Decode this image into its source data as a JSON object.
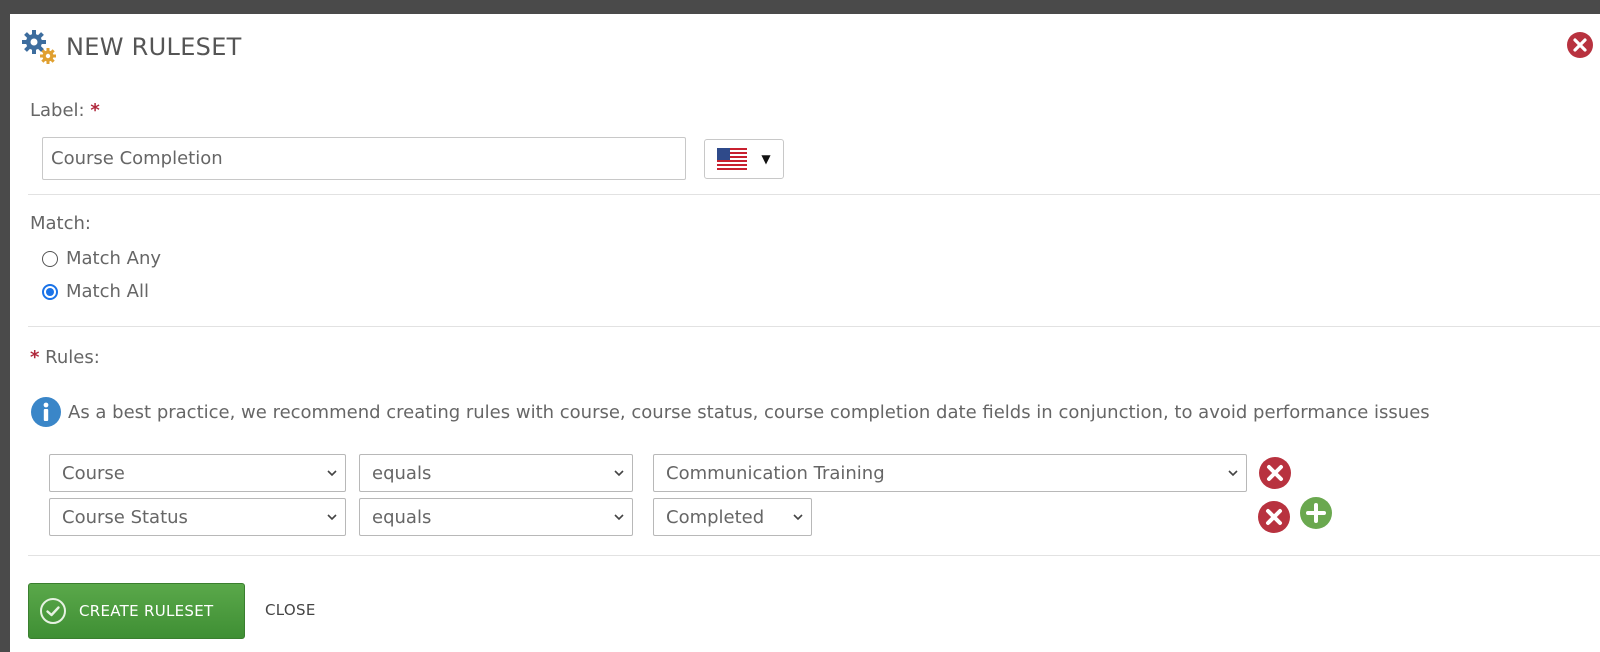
{
  "dialog": {
    "title": "NEW RULESET",
    "icon": "gears-icon",
    "close_icon": "close-circle-icon"
  },
  "label_section": {
    "label": "Label:",
    "required_mark": "*",
    "value": "Course Completion",
    "language_flag": "us-flag-icon",
    "dropdown_caret": "▼"
  },
  "match_section": {
    "label": "Match:",
    "options": [
      {
        "label": "Match Any",
        "checked": false
      },
      {
        "label": "Match All",
        "checked": true
      }
    ]
  },
  "rules_section": {
    "required_mark": "*",
    "label": "Rules:",
    "info_text": "As a best practice, we recommend creating rules with course, course status, course completion date fields in conjunction, to avoid performance issues",
    "rules": [
      {
        "field": "Course",
        "operator": "equals",
        "value": "Communication Training"
      },
      {
        "field": "Course Status",
        "operator": "equals",
        "value": "Completed"
      }
    ]
  },
  "footer": {
    "create_label": "CREATE RULESET",
    "close_label": "CLOSE"
  },
  "colors": {
    "accent_green": "#4a9c3e",
    "remove_red": "#b8323f",
    "add_green": "#6aa84f",
    "info_blue": "#3a86c8"
  }
}
